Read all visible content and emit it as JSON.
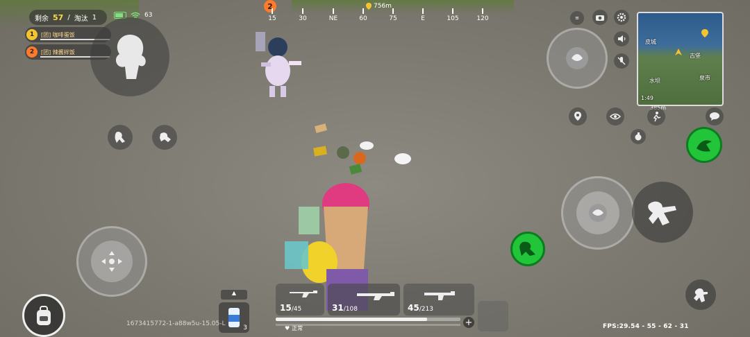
{
  "hud": {
    "alive_label": "剩余",
    "alive_count": "57",
    "separator": "/",
    "eliminated_label": "淘汰",
    "eliminated_count": "1",
    "signal_value": "63"
  },
  "team": [
    {
      "number": "1",
      "name": "[团] 咖啡蛋饭",
      "color": "#f4c430"
    },
    {
      "number": "2",
      "name": "[团] 辣酱拌饭",
      "color": "#ff7a2a"
    }
  ],
  "compass": {
    "ticks": [
      "15",
      "30",
      "NE",
      "60",
      "75",
      "E",
      "105",
      "120"
    ],
    "waypoint_distance": "756m",
    "teammate_marker": "2"
  },
  "minimap": {
    "labels": [
      "皮城",
      "古堡",
      "泉市",
      "水坝"
    ],
    "timer": "1:49",
    "distance": "385m"
  },
  "weapons": [
    {
      "ammo": "15",
      "reserve": "45"
    },
    {
      "ammo": "31",
      "reserve": "108"
    },
    {
      "ammo": "45",
      "reserve": "213"
    }
  ],
  "status_label": "正常",
  "health_fraction": 0.82,
  "item_count": "3",
  "watermark": "1673415772-1-a88w5u-15.05-L",
  "fps_text": "FPS:29.54 - 55 - 62 - 31",
  "colors": {
    "accent_green": "#22c43a",
    "counter_yellow": "#ffd84a",
    "teammate_orange": "#ff7a2a"
  }
}
